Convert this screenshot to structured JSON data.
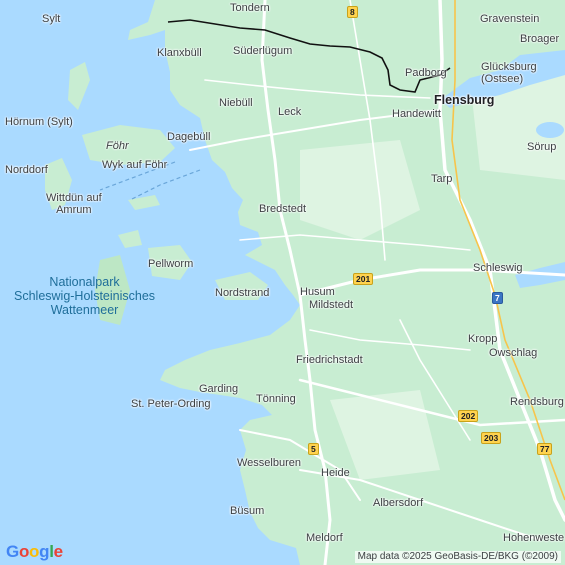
{
  "map": {
    "colors": {
      "water": "#aadaff",
      "land": "#c8edd2",
      "land_light": "#def4e2",
      "road": "#ffffff",
      "border": "#111111"
    },
    "places": [
      {
        "name": "Tondern"
      },
      {
        "name": "Gravenstein"
      },
      {
        "name": "Sylt"
      },
      {
        "name": "Broager"
      },
      {
        "name": "Klanxbüll"
      },
      {
        "name": "Süderlügum"
      },
      {
        "name": "Padborg"
      },
      {
        "name": "Glücksburg\n(Ostsee)"
      },
      {
        "name": "Flensburg"
      },
      {
        "name": "Niebüll"
      },
      {
        "name": "Leck"
      },
      {
        "name": "Handewitt"
      },
      {
        "name": "Hörnum (Sylt)"
      },
      {
        "name": "Föhr"
      },
      {
        "name": "Dagebüll"
      },
      {
        "name": "Sörup"
      },
      {
        "name": "Norddorf"
      },
      {
        "name": "Wyk auf Föhr"
      },
      {
        "name": "Tarp"
      },
      {
        "name": "Wittdün auf\nAmrum"
      },
      {
        "name": "Bredstedt"
      },
      {
        "name": "Pellworm"
      },
      {
        "name": "Schleswig"
      },
      {
        "name": "Nationalpark\nSchleswig-Holsteinisches\nWattenmeer"
      },
      {
        "name": "Nordstrand"
      },
      {
        "name": "Husum"
      },
      {
        "name": "Mildstedt"
      },
      {
        "name": "Kropp"
      },
      {
        "name": "Owschlag"
      },
      {
        "name": "Friedrichstadt"
      },
      {
        "name": "Garding"
      },
      {
        "name": "St. Peter-Ording"
      },
      {
        "name": "Tönning"
      },
      {
        "name": "Rendsburg"
      },
      {
        "name": "Wesselburen"
      },
      {
        "name": "Heide"
      },
      {
        "name": "Albersdorf"
      },
      {
        "name": "Büsum"
      },
      {
        "name": "Hohenweste"
      },
      {
        "name": "Meldorf"
      }
    ],
    "shields": [
      {
        "label": "8"
      },
      {
        "label": "201"
      },
      {
        "label": "7"
      },
      {
        "label": "202"
      },
      {
        "label": "203"
      },
      {
        "label": "5"
      },
      {
        "label": "77"
      }
    ],
    "logo": "Google",
    "attribution": "Map data ©2025 GeoBasis-DE/BKG (©2009)"
  }
}
